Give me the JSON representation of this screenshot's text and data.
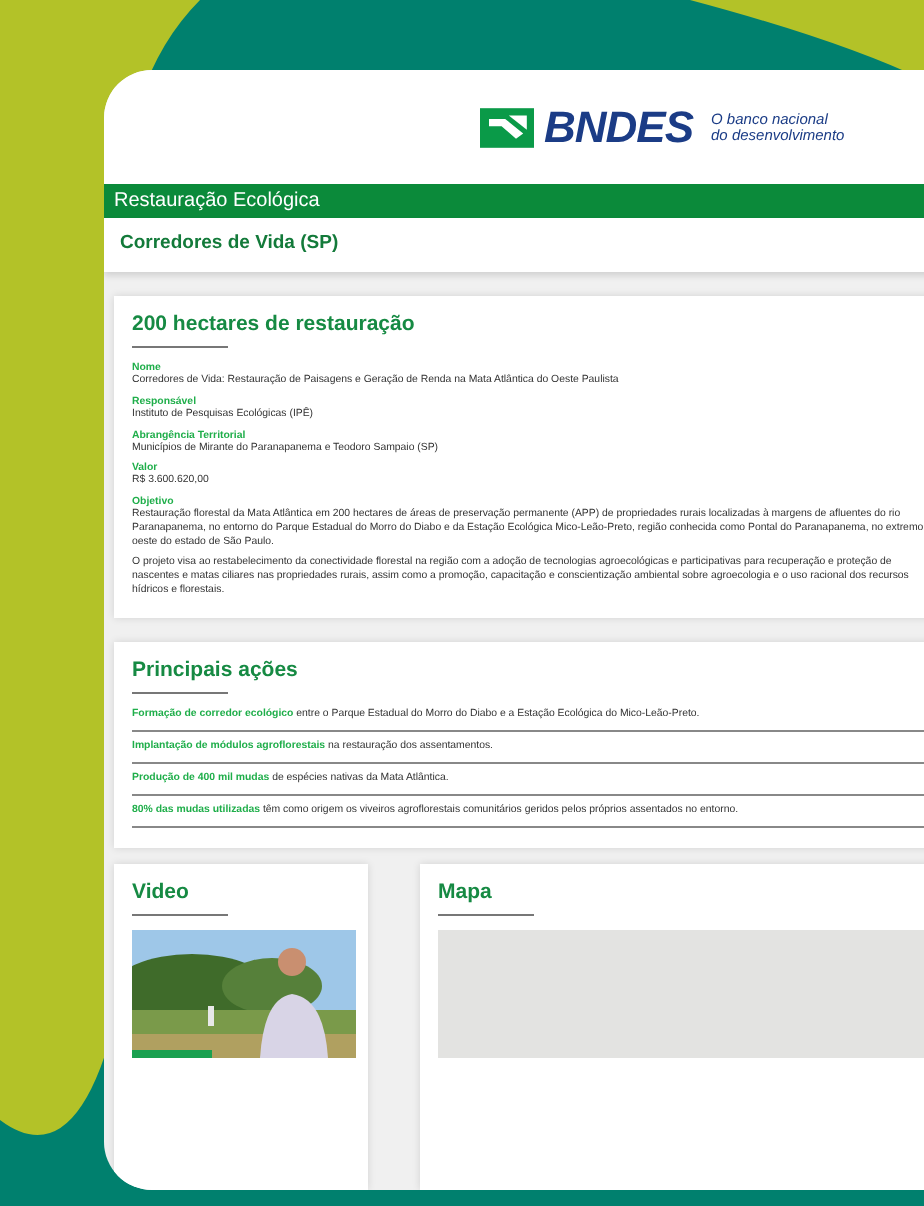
{
  "brand": {
    "name": "BNDES",
    "tagline": [
      "O banco nacional",
      "do desenvolvimento"
    ]
  },
  "category": "Restauração Ecológica",
  "project": "Corredores de Vida (SP)",
  "summary": {
    "title": "200 hectares de restauração",
    "fields": [
      {
        "label": "Nome",
        "paragraphs": [
          "Corredores de Vida: Restauração de Paisagens e Geração de Renda na Mata Atlântica do Oeste Paulista"
        ]
      },
      {
        "label": "Responsável",
        "paragraphs": [
          "Instituto de Pesquisas Ecológicas (IPÊ)"
        ]
      },
      {
        "label": "Abrangência Territorial",
        "paragraphs": [
          "Municípios de Mirante do Paranapanema e Teodoro Sampaio (SP)"
        ]
      },
      {
        "label": "Valor",
        "paragraphs": [
          "R$ 3.600.620,00"
        ]
      },
      {
        "label": "Objetivo",
        "paragraphs": [
          "Restauração florestal da Mata Atlântica em 200 hectares de áreas de preservação permanente (APP) de propriedades rurais localizadas à margens de afluentes do rio Paranapanema, no entorno do Parque Estadual do Morro do Diabo e da Estação Ecológica Mico-Leão-Preto, região conhecida como Pontal do Paranapanema, no extremo oeste do estado de São Paulo.",
          "O projeto visa ao restabelecimento da conectividade florestal na região com a adoção de tecnologias agroecológicas e participativas para recuperação e proteção de nascentes e matas ciliares nas propriedades rurais, assim como a promoção, capacitação e conscientização ambiental sobre agroecologia e o uso racional dos recursos hídricos e florestais."
        ]
      }
    ]
  },
  "actions": {
    "title": "Principais ações",
    "items": [
      "**Formação de corredor ecológico** entre o Parque Estadual do Morro do Diabo e a Estação Ecológica do Mico-Leão-Preto.",
      "**Implantação de módulos agroflorestais** na restauração dos assentamentos.",
      "**Produção de 400 mil mudas** de espécies nativas da Mata Atlântica.",
      "**80% das mudas utilizadas** têm como origem os viveiros agroflorestais comunitários geridos pelos próprios assentados no entorno."
    ]
  },
  "media": [
    {
      "title": "Video",
      "kind": "video"
    },
    {
      "title": "Mapa",
      "kind": "map"
    }
  ]
}
